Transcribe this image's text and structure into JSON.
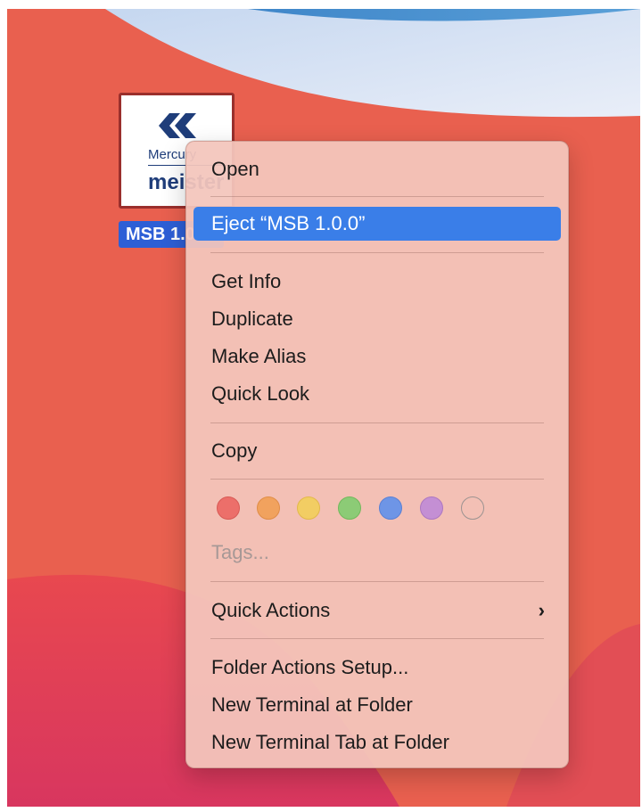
{
  "volume": {
    "brand_top": "Mercury",
    "brand_bottom": "meister",
    "label": "MSB 1.0.0"
  },
  "menu": {
    "open": "Open",
    "eject": "Eject “MSB 1.0.0”",
    "get_info": "Get Info",
    "duplicate": "Duplicate",
    "make_alias": "Make Alias",
    "quick_look": "Quick Look",
    "copy": "Copy",
    "tags": "Tags...",
    "quick_actions": "Quick Actions",
    "quick_actions_chevron": "›",
    "folder_actions_setup": "Folder Actions Setup...",
    "new_terminal": "New Terminal at Folder",
    "new_terminal_tab": "New Terminal Tab at Folder"
  },
  "tag_colors": [
    {
      "name": "red",
      "fill": "#ec6f6a",
      "stroke": "#d85a55"
    },
    {
      "name": "orange",
      "fill": "#f1a25e",
      "stroke": "#e08d47"
    },
    {
      "name": "yellow",
      "fill": "#f2cd63",
      "stroke": "#e3b84b"
    },
    {
      "name": "green",
      "fill": "#8ccb76",
      "stroke": "#72b85c"
    },
    {
      "name": "blue",
      "fill": "#6e95e6",
      "stroke": "#5a80d4"
    },
    {
      "name": "purple",
      "fill": "#c48fd4",
      "stroke": "#ad77c0"
    },
    {
      "name": "none",
      "fill": "transparent",
      "stroke": "#9c9391"
    }
  ],
  "colors": {
    "selection": "#3a7ee8",
    "label_highlight": "#2d5fd6"
  }
}
